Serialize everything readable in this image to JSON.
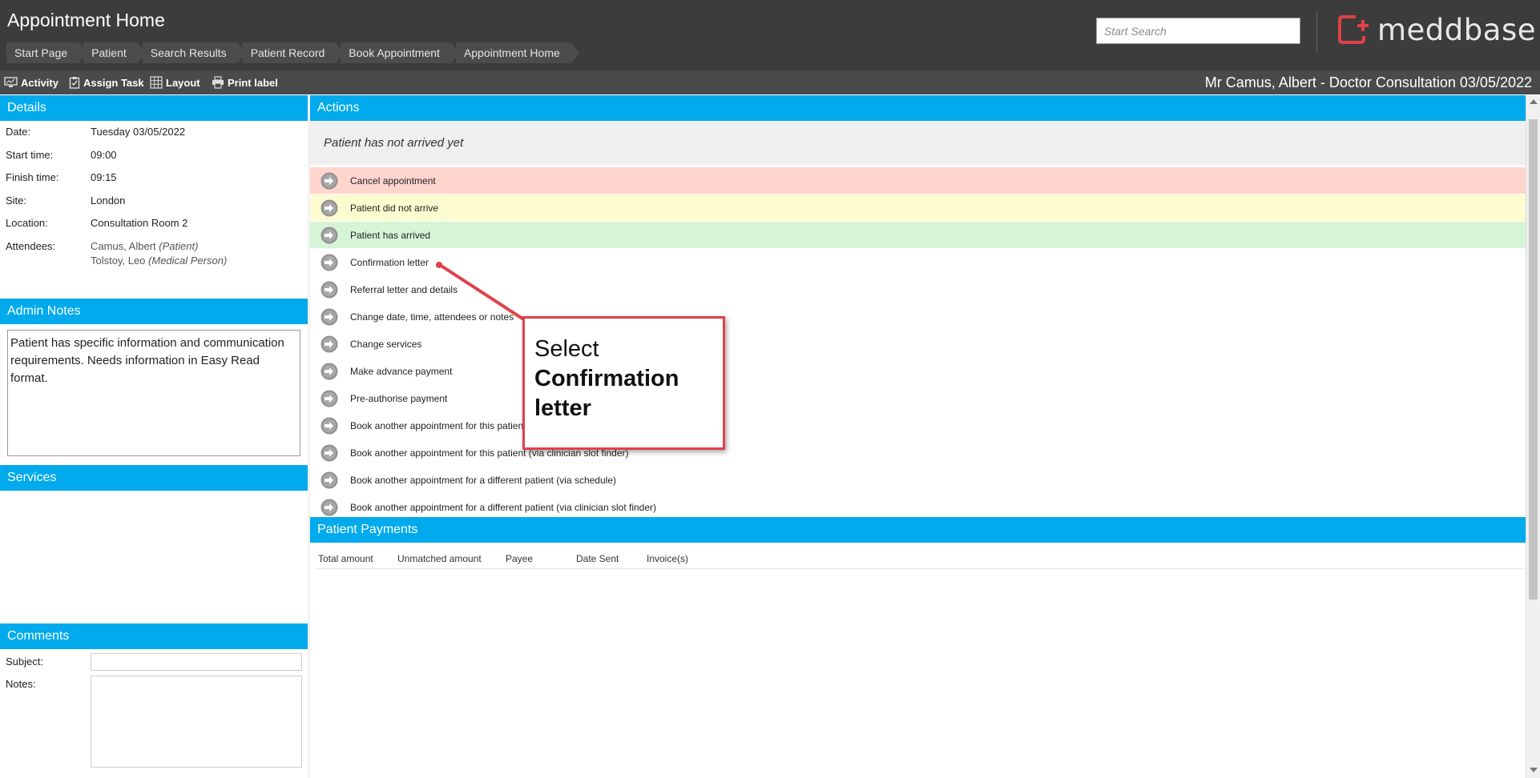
{
  "header": {
    "title": "Appointment Home",
    "breadcrumb": [
      "Start Page",
      "Patient",
      "Search Results",
      "Patient Record",
      "Book Appointment",
      "Appointment Home"
    ],
    "search_placeholder": "Start Search",
    "logo_text": "meddbase"
  },
  "toolbar": {
    "items": [
      "Activity",
      "Assign Task",
      "Layout",
      "Print label"
    ],
    "appointment_title": "Mr Camus, Albert - Doctor Consultation 03/05/2022"
  },
  "details": {
    "header": "Details",
    "rows": [
      {
        "label": "Date:",
        "value": "Tuesday 03/05/2022"
      },
      {
        "label": "Start time:",
        "value": "09:00"
      },
      {
        "label": "Finish time:",
        "value": "09:15"
      },
      {
        "label": "Site:",
        "value": "London"
      },
      {
        "label": "Location:",
        "value": "Consultation Room 2"
      }
    ],
    "attendees_label": "Attendees:",
    "attendees": [
      {
        "name": "Camus, Albert",
        "role": "(Patient)"
      },
      {
        "name": "Tolstoy, Leo",
        "role": "(Medical Person)"
      }
    ]
  },
  "admin_notes": {
    "header": "Admin Notes",
    "text": "Patient has specific information and communication requirements. Needs information in Easy Read format."
  },
  "services": {
    "header": "Services"
  },
  "comments": {
    "header": "Comments",
    "subject_label": "Subject:",
    "notes_label": "Notes:"
  },
  "actions": {
    "header": "Actions",
    "status": "Patient has not arrived yet",
    "items": [
      {
        "label": "Cancel appointment",
        "tone": "red"
      },
      {
        "label": "Patient did not arrive",
        "tone": "yellow"
      },
      {
        "label": "Patient has arrived",
        "tone": "green"
      },
      {
        "label": "Confirmation letter",
        "tone": "none"
      },
      {
        "label": "Referral letter and details",
        "tone": "none"
      },
      {
        "label": "Change date, time, attendees or notes",
        "tone": "none"
      },
      {
        "label": "Change services",
        "tone": "none"
      },
      {
        "label": "Make advance payment",
        "tone": "none"
      },
      {
        "label": "Pre-authorise payment",
        "tone": "none"
      },
      {
        "label": "Book another appointment for this patient (via schedule)",
        "tone": "none"
      },
      {
        "label": "Book another appointment for this patient (via clinician slot finder)",
        "tone": "none"
      },
      {
        "label": "Book another appointment for a different patient (via schedule)",
        "tone": "none"
      },
      {
        "label": "Book another appointment for a different patient (via clinician slot finder)",
        "tone": "none"
      }
    ]
  },
  "payments": {
    "header": "Patient Payments",
    "columns": [
      "Total amount",
      "Unmatched amount",
      "Payee",
      "Date Sent",
      "Invoice(s)"
    ]
  },
  "callout": {
    "line1": "Select",
    "line2": "Confirmation letter"
  },
  "colors": {
    "accent": "#00aaec",
    "header_bg": "#3c3c3c",
    "logo_red": "#e0414a",
    "callout_border": "#e0414a"
  }
}
